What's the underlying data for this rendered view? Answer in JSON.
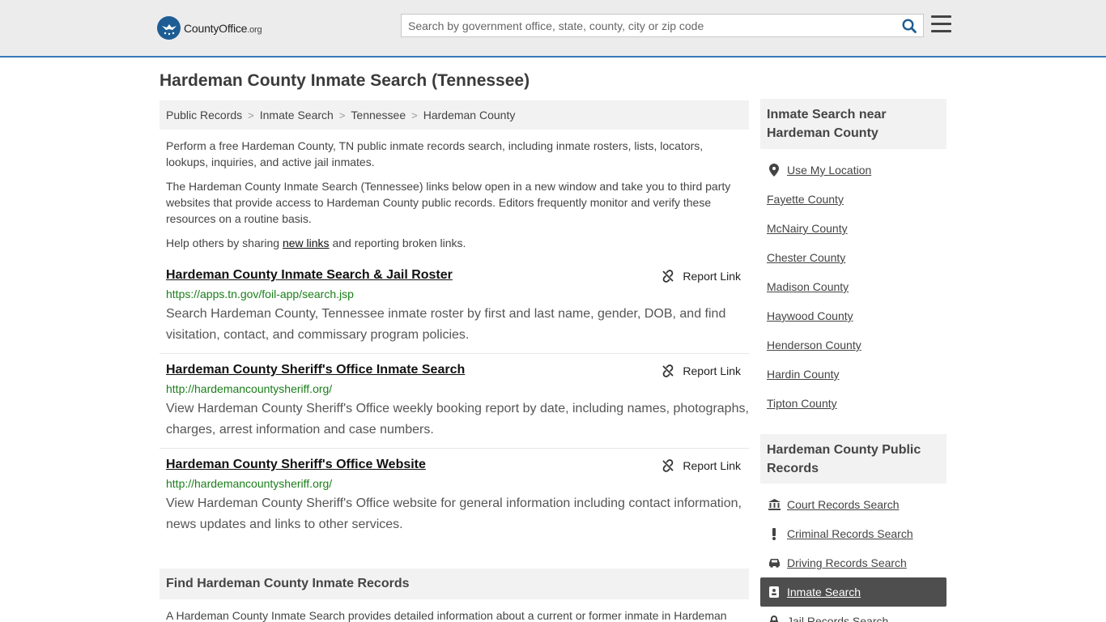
{
  "header": {
    "logo_main": "CountyOffice",
    "logo_suffix": ".org",
    "search_placeholder": "Search by government office, state, county, city or zip code"
  },
  "page_title": "Hardeman County Inmate Search (Tennessee)",
  "breadcrumb": [
    "Public Records",
    "Inmate Search",
    "Tennessee",
    "Hardeman County"
  ],
  "breadcrumb_sep": ">",
  "intro": {
    "p1": "Perform a free Hardeman County, TN public inmate records search, including inmate rosters, lists, locators, lookups, inquiries, and active jail inmates.",
    "p2": "The Hardeman County Inmate Search (Tennessee) links below open in a new window and take you to third party websites that provide access to Hardeman County public records. Editors frequently monitor and verify these resources on a routine basis.",
    "p3_before": "Help others by sharing ",
    "p3_link": "new links",
    "p3_after": " and reporting broken links."
  },
  "report_label": "Report Link",
  "results": [
    {
      "title": "Hardeman County Inmate Search & Jail Roster",
      "url": "https://apps.tn.gov/foil-app/search.jsp",
      "desc": "Search Hardeman County, Tennessee inmate roster by first and last name, gender, DOB, and find visitation, contact, and commissary program policies."
    },
    {
      "title": "Hardeman County Sheriff's Office Inmate Search",
      "url": "http://hardemancountysheriff.org/",
      "desc": "View Hardeman County Sheriff's Office weekly booking report by date, including names, photographs, charges, arrest information and case numbers."
    },
    {
      "title": "Hardeman County Sheriff's Office Website",
      "url": "http://hardemancountysheriff.org/",
      "desc": "View Hardeman County Sheriff's Office website for general information including contact information, news updates and links to other services."
    }
  ],
  "find_section": {
    "heading": "Find Hardeman County Inmate Records",
    "text": "A Hardeman County Inmate Search provides detailed information about a current or former inmate in Hardeman"
  },
  "sidebar": {
    "nearby_heading": "Inmate Search near Hardeman County",
    "use_location": "Use My Location",
    "nearby": [
      "Fayette County",
      "McNairy County",
      "Chester County",
      "Madison County",
      "Haywood County",
      "Henderson County",
      "Hardin County",
      "Tipton County"
    ],
    "records_heading": "Hardeman County Public Records",
    "records": [
      {
        "label": "Court Records Search",
        "icon": "courthouse-icon"
      },
      {
        "label": "Criminal Records Search",
        "icon": "exclamation-icon"
      },
      {
        "label": "Driving Records Search",
        "icon": "car-icon"
      },
      {
        "label": "Inmate Search",
        "icon": "id-badge-icon"
      },
      {
        "label": "Jail Records Search",
        "icon": "lock-icon"
      }
    ]
  },
  "colors": {
    "accent": "#3a7ab8",
    "url_green": "#1a7f1a",
    "active_bg": "#4e4e4e"
  }
}
